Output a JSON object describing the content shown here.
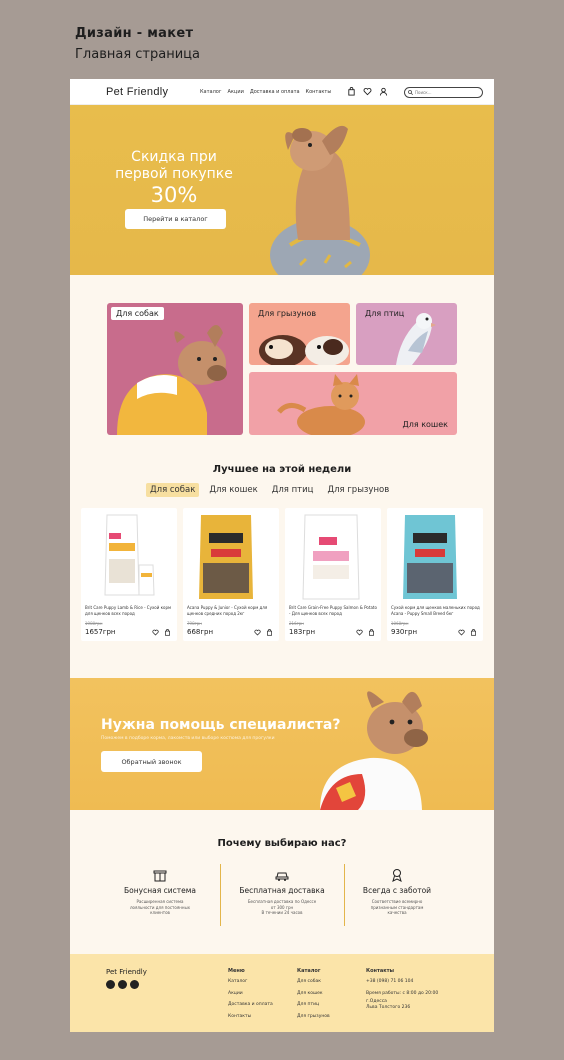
{
  "caption": {
    "title": "Дизайн - макет",
    "subtitle": "Главная страница"
  },
  "header": {
    "logo": "Pet Friendly",
    "nav": [
      "Каталог",
      "Акции",
      "Доставка и оплата",
      "Контакты"
    ],
    "search_placeholder": "Поиск..."
  },
  "hero": {
    "line1": "Скидка при",
    "line2": "первой покупке",
    "percent": "30%",
    "button": "Перейти в каталог"
  },
  "categories": {
    "dogs": "Для собак",
    "rodents": "Для грызунов",
    "birds": "Для птиц",
    "cats": "Для кошек"
  },
  "best": {
    "title": "Лучшее на этой недели",
    "tabs": [
      "Для собак",
      "Для кошек",
      "Для птиц",
      "Для грызунов"
    ],
    "active_tab": "Для собак"
  },
  "products": [
    {
      "name": "Brit Care Puppy Lamb & Rice - Сухой корм для щенков всех пород",
      "old_price": "1980грн",
      "price": "1657грн",
      "bag_color": "#ffffff",
      "brand": "Brit care"
    },
    {
      "name": "Acana Puppy & Junior - Сухой корм для щенков средних пород 2кг",
      "old_price": "798грн",
      "price": "668грн",
      "bag_color": "#e8b43a",
      "brand": "ACANA"
    },
    {
      "name": "Brit Care Grain-Free Puppy Salmon & Potato - Для щенков всех пород",
      "old_price": "216грн",
      "price": "183грн",
      "bag_color": "#ffffff",
      "brand": "Brit care"
    },
    {
      "name": "Сухой корм для щенков маленьких пород Acana - Puppy Small Breed 6кг",
      "old_price": "1068грн",
      "price": "930грн",
      "bag_color": "#6fc5d4",
      "brand": "ACANA"
    }
  ],
  "help": {
    "title": "Нужна помощь специалиста?",
    "subtitle": "Поможем в подборе корма, лакомств или выборе костюма для прогулки",
    "button": "Обратный звонок"
  },
  "why": {
    "title": "Почему выбираю нас?",
    "features": [
      {
        "title": "Бонусная система",
        "desc1": "Расширенная система",
        "desc2": "лояльности для постоянных",
        "desc3": "клиентов",
        "icon": "gift-icon"
      },
      {
        "title": "Бесплатная доставка",
        "desc1": "Бесплатная доставка по Одессе",
        "desc2": "от 300 грн",
        "desc3": "В течении 24 часов",
        "icon": "car-icon"
      },
      {
        "title": "Всегда с заботой",
        "desc1": "Соответствие всемирно",
        "desc2": "признанным стандартам",
        "desc3": "качества",
        "icon": "award-icon"
      }
    ]
  },
  "footer": {
    "brand": "Pet Friendly",
    "menu": {
      "heading": "Меню",
      "items": [
        "Каталог",
        "Акции",
        "Доставка и оплата",
        "Контакты"
      ]
    },
    "catalog": {
      "heading": "Каталог",
      "items": [
        "Для собак",
        "Для кошек",
        "Для птиц",
        "Для грызунов"
      ]
    },
    "contacts": {
      "heading": "Контакты",
      "phone": "+38 (098) 71 06 104",
      "hours": "Время работы: с 8:00 до 20:00",
      "city": "г.Одесса",
      "street": "Льва Толстого 236"
    }
  },
  "colors": {
    "accent": "#e8bd4c",
    "page_bg": "#fdf7ee",
    "footer_bg": "#fbe4a9",
    "outer_bg": "#a69b94",
    "tab_active": "#f7dfa0"
  }
}
